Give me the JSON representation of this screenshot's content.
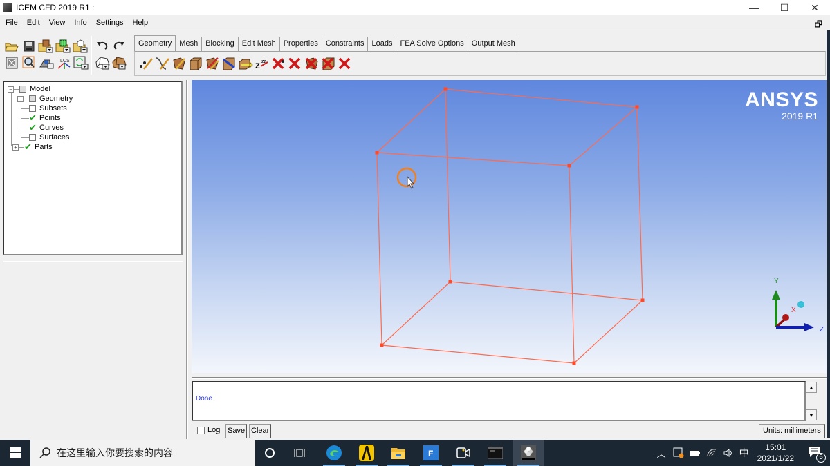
{
  "window": {
    "title": "ICEM CFD 2019 R1 :",
    "controls": {
      "minimize": "—",
      "maximize": "☐",
      "close": "✕"
    }
  },
  "menu": [
    "File",
    "Edit",
    "View",
    "Info",
    "Settings",
    "Help"
  ],
  "toolbar": {
    "left_row1": [
      "open-project-icon",
      "save-project-icon",
      "open-geometry-icon",
      "open-mesh-icon",
      "open-blocking-icon",
      "undo-icon",
      "redo-icon"
    ],
    "left_row2": [
      "fit-window-icon",
      "zoom-box-icon",
      "measure-icon",
      "local-coords-icon",
      "refresh-icon",
      "wireframe-icon",
      "solid-icon"
    ],
    "tabs": [
      "Geometry",
      "Mesh",
      "Blocking",
      "Edit Mesh",
      "Properties",
      "Constraints",
      "Loads",
      "FEA Solve Options",
      "Output Mesh"
    ],
    "active_tab": "Geometry",
    "geometry_tools": [
      "create-point-icon",
      "create-curve-icon",
      "create-surface-icon",
      "create-body-icon",
      "create-faceted-icon",
      "repair-geometry-icon",
      "geometry-transform-icon",
      "restore-entities-icon",
      "delete-point-icon",
      "delete-curve-icon",
      "delete-surface-icon",
      "delete-body-icon",
      "delete-any-entity-icon"
    ]
  },
  "tree": {
    "items": [
      {
        "label": "Model",
        "expander": "minus",
        "state": "partial"
      },
      {
        "label": "Geometry",
        "expander": "minus",
        "state": "partial"
      },
      {
        "label": "Subsets",
        "state": "unchecked"
      },
      {
        "label": "Points",
        "state": "checked"
      },
      {
        "label": "Curves",
        "state": "checked"
      },
      {
        "label": "Surfaces",
        "state": "unchecked"
      },
      {
        "label": "Parts",
        "expander": "plus",
        "state": "checked"
      }
    ]
  },
  "viewport": {
    "brand": "ANSYS",
    "version": "2019 R1",
    "geometry_color": "#ff6a4d",
    "axes": {
      "y": "Y",
      "x": "X",
      "z": "Z"
    }
  },
  "messages": {
    "lines": [
      "Done"
    ],
    "log_label": "Log",
    "save_label": "Save",
    "clear_label": "Clear",
    "units": "Units: millimeters"
  },
  "taskbar": {
    "search_placeholder": "在这里输入你要搜索的内容",
    "apps": [
      "cortana-icon",
      "task-view-icon",
      "edge-icon",
      "app-a-icon",
      "file-explorer-icon",
      "foxit-icon",
      "camera-icon",
      "terminal-icon",
      "icem-icon"
    ],
    "ime": "中",
    "time": "15:01",
    "date": "2021/1/22",
    "notifications": "5"
  }
}
